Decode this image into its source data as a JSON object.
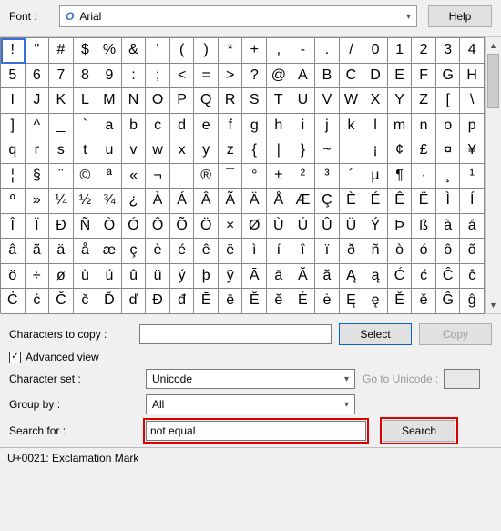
{
  "top": {
    "font_label": "Font :",
    "font_icon": "O",
    "font_value": "Arial",
    "help_label": "Help"
  },
  "grid": {
    "selected_index": 0,
    "chars": [
      "!",
      "\"",
      "#",
      "$",
      "%",
      "&",
      "'",
      "(",
      ")",
      "*",
      "+",
      ",",
      "-",
      ".",
      "/",
      "0",
      "1",
      "2",
      "3",
      "4",
      "5",
      "6",
      "7",
      "8",
      "9",
      ":",
      ";",
      "<",
      "=",
      ">",
      "?",
      "@",
      "A",
      "B",
      "C",
      "D",
      "E",
      "F",
      "G",
      "H",
      "I",
      "J",
      "K",
      "L",
      "M",
      "N",
      "O",
      "P",
      "Q",
      "R",
      "S",
      "T",
      "U",
      "V",
      "W",
      "X",
      "Y",
      "Z",
      "[",
      "\\",
      "]",
      "^",
      "_",
      "`",
      "a",
      "b",
      "c",
      "d",
      "e",
      "f",
      "g",
      "h",
      "i",
      "j",
      "k",
      "l",
      "m",
      "n",
      "o",
      "p",
      "q",
      "r",
      "s",
      "t",
      "u",
      "v",
      "w",
      "x",
      "y",
      "z",
      "{",
      "|",
      "}",
      "~",
      "",
      "¡",
      "¢",
      "£",
      "¤",
      "¥",
      "¦",
      "§",
      "¨",
      "©",
      "ª",
      "«",
      "¬",
      "­",
      "®",
      "¯",
      "°",
      "±",
      "²",
      "³",
      "´",
      "µ",
      "¶",
      "·",
      "¸",
      "¹",
      "º",
      "»",
      "¼",
      "½",
      "¾",
      "¿",
      "À",
      "Á",
      "Â",
      "Ã",
      "Ä",
      "Å",
      "Æ",
      "Ç",
      "È",
      "É",
      "Ê",
      "Ë",
      "Ì",
      "Í",
      "Î",
      "Ï",
      "Ð",
      "Ñ",
      "Ò",
      "Ó",
      "Ô",
      "Õ",
      "Ö",
      "×",
      "Ø",
      "Ù",
      "Ú",
      "Û",
      "Ü",
      "Ý",
      "Þ",
      "ß",
      "à",
      "á",
      "â",
      "ã",
      "ä",
      "å",
      "æ",
      "ç",
      "è",
      "é",
      "ê",
      "ë",
      "ì",
      "í",
      "î",
      "ï",
      "ð",
      "ñ",
      "ò",
      "ó",
      "ô",
      "õ",
      "ö",
      "÷",
      "ø",
      "ù",
      "ú",
      "û",
      "ü",
      "ý",
      "þ",
      "ÿ",
      "Ā",
      "ā",
      "Ă",
      "ă",
      "Ą",
      "ą",
      "Ć",
      "ć",
      "Ĉ",
      "ĉ",
      "Ċ",
      "ċ",
      "Č",
      "č",
      "Ď",
      "ď",
      "Đ",
      "đ",
      "Ē",
      "ē",
      "Ĕ",
      "ĕ",
      "Ė",
      "ė",
      "Ę",
      "ę",
      "Ě",
      "ě",
      "Ĝ",
      "ĝ"
    ]
  },
  "copy": {
    "label": "Characters to copy :",
    "value": "",
    "select_label": "Select",
    "copy_label": "Copy"
  },
  "advanced": {
    "checked": true,
    "label": "Advanced view"
  },
  "charset": {
    "label": "Character set :",
    "value": "Unicode",
    "goto_label": "Go to Unicode :",
    "goto_value": ""
  },
  "groupby": {
    "label": "Group by :",
    "value": "All"
  },
  "search": {
    "label": "Search for :",
    "value": "not equal",
    "button_label": "Search"
  },
  "status": {
    "text": "U+0021: Exclamation Mark"
  }
}
